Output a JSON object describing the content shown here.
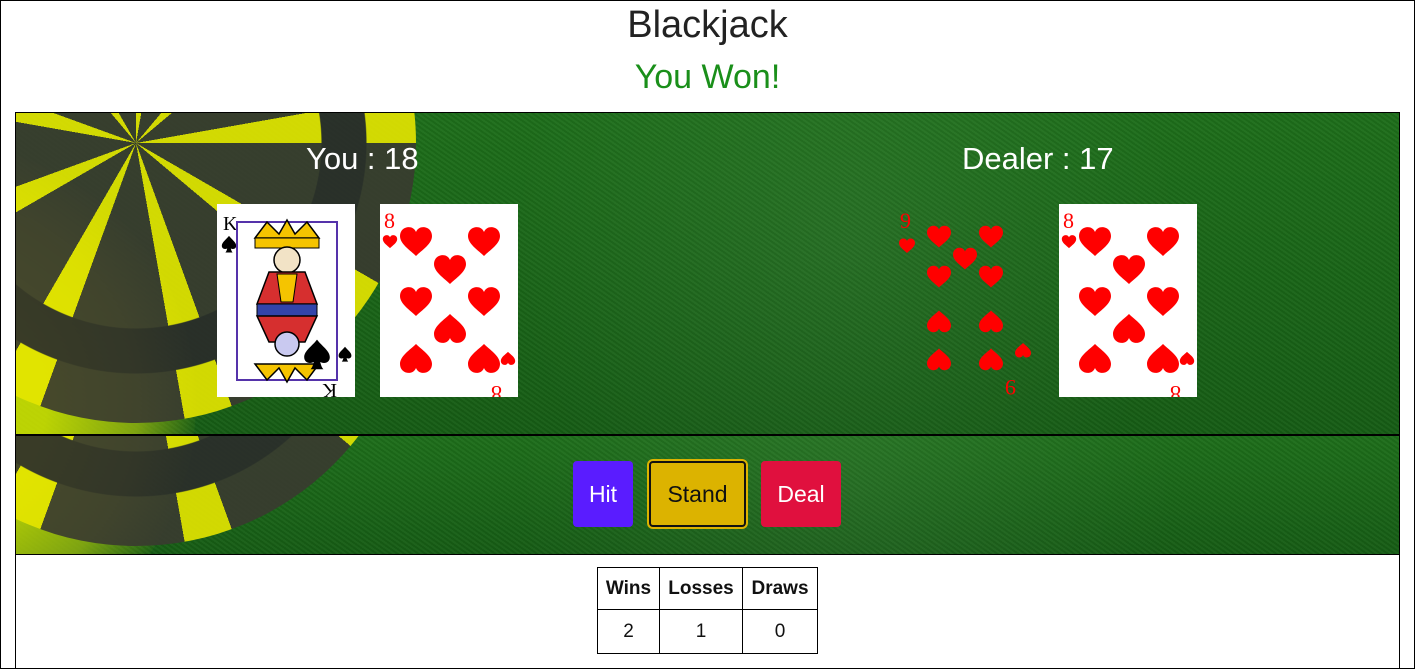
{
  "header": {
    "title": "Blackjack",
    "result": "You Won!"
  },
  "players": {
    "you": {
      "label": "You : 18",
      "cards": [
        {
          "rank": "K",
          "suit": "spades"
        },
        {
          "rank": "8",
          "suit": "hearts"
        }
      ]
    },
    "dealer": {
      "label": "Dealer : 17",
      "cards": [
        {
          "rank": "9",
          "suit": "hearts"
        },
        {
          "rank": "8",
          "suit": "hearts"
        }
      ]
    }
  },
  "controls": {
    "hit_label": "Hit",
    "stand_label": "Stand",
    "deal_label": "Deal"
  },
  "scoreboard": {
    "headers": [
      "Wins",
      "Losses",
      "Draws"
    ],
    "values": [
      "2",
      "1",
      "0"
    ]
  },
  "colors": {
    "result_text": "#1a8f1a",
    "hit_button": "#5a1cff",
    "stand_button": "#dcb300",
    "deal_button": "#e0103e",
    "felt": "#1d6e1a",
    "heart": "#ff0000"
  },
  "icons": {
    "suit_spades": "spade-icon",
    "suit_hearts": "heart-icon"
  }
}
